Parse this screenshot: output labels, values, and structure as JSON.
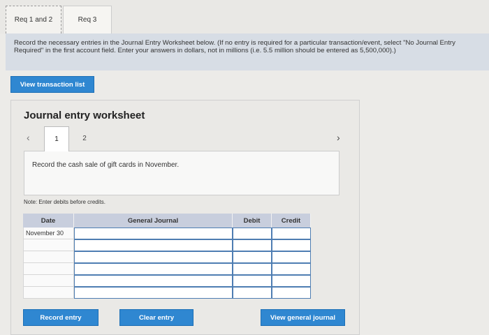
{
  "tabs": [
    {
      "label": "Req 1 and 2"
    },
    {
      "label": "Req 3"
    }
  ],
  "instructions": "Record the necessary entries in the Journal Entry Worksheet below. (If no entry is required for a particular transaction/event, select \"No Journal Entry Required\" in the first account field. Enter your answers in dollars, not in millions (i.e. 5.5 million should be entered as 5,500,000).)",
  "buttons": {
    "view_transaction_list": "View transaction list",
    "record_entry": "Record entry",
    "clear_entry": "Clear entry",
    "view_general_journal": "View general journal"
  },
  "worksheet": {
    "title": "Journal entry worksheet",
    "pages": [
      "1",
      "2"
    ],
    "prev_icon": "‹",
    "next_icon": "›",
    "description": "Record the cash sale of gift cards in November.",
    "note": "Note: Enter debits before credits.",
    "columns": [
      "Date",
      "General Journal",
      "Debit",
      "Credit"
    ],
    "rows": [
      {
        "date": "November 30",
        "account": "",
        "debit": "",
        "credit": ""
      },
      {
        "date": "",
        "account": "",
        "debit": "",
        "credit": ""
      },
      {
        "date": "",
        "account": "",
        "debit": "",
        "credit": ""
      },
      {
        "date": "",
        "account": "",
        "debit": "",
        "credit": ""
      },
      {
        "date": "",
        "account": "",
        "debit": "",
        "credit": ""
      },
      {
        "date": "",
        "account": "",
        "debit": "",
        "credit": ""
      }
    ]
  },
  "colors": {
    "accent": "#2f87d1",
    "instruction_bg": "#d7dde5",
    "grid_header_bg": "#c8cedd"
  }
}
